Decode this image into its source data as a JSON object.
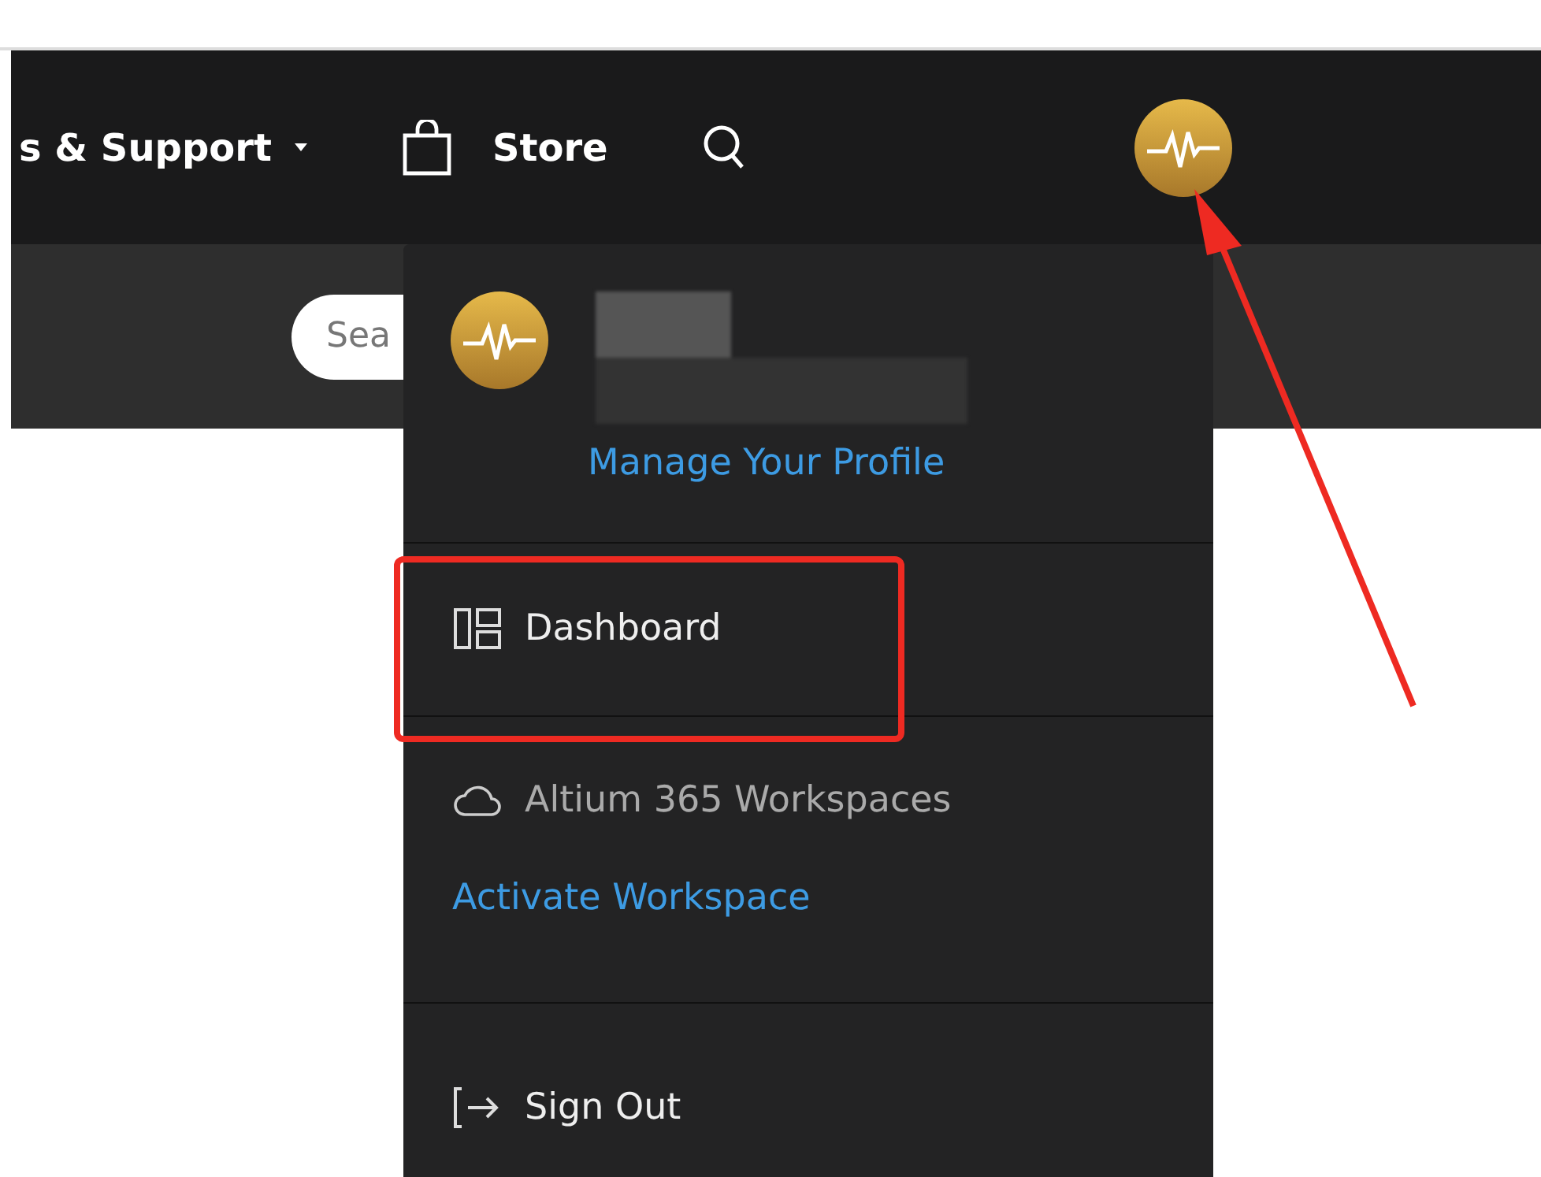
{
  "nav": {
    "support_label": "s & Support",
    "store_label": "Store"
  },
  "search": {
    "placeholder": "Sea"
  },
  "profile_menu": {
    "manage_link": "Manage Your Profile",
    "items": [
      {
        "kind": "dashboard",
        "label": "Dashboard"
      },
      {
        "kind": "workspaces",
        "label": "Altium 365 Workspaces",
        "link": "Activate Workspace"
      },
      {
        "kind": "signout",
        "label": "Sign Out"
      }
    ]
  }
}
